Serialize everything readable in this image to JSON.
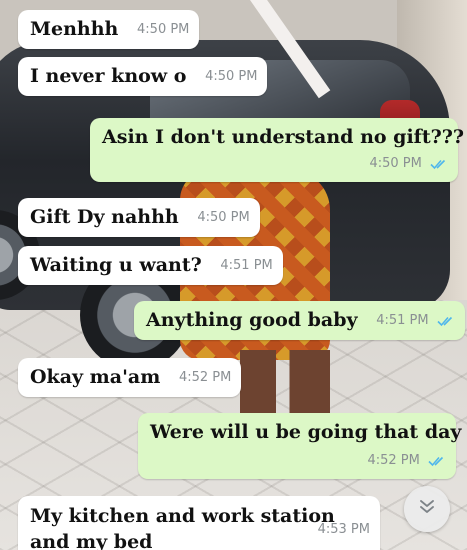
{
  "messages": [
    {
      "id": "m1",
      "direction": "incoming",
      "text": "Menhhh",
      "time": "4:50 PM"
    },
    {
      "id": "m2",
      "direction": "incoming",
      "text": "I never know o",
      "time": "4:50 PM"
    },
    {
      "id": "m3",
      "direction": "outgoing",
      "text": "Asin I don't understand no gift???",
      "time": "4:50 PM",
      "status": "read"
    },
    {
      "id": "m4",
      "direction": "incoming",
      "text": "Gift Dy nahhh",
      "time": "4:50 PM"
    },
    {
      "id": "m5",
      "direction": "incoming",
      "text": "Waiting u want?",
      "time": "4:51 PM"
    },
    {
      "id": "m6",
      "direction": "outgoing",
      "text": "Anything good baby",
      "time": "4:51 PM",
      "status": "read"
    },
    {
      "id": "m7",
      "direction": "incoming",
      "text": "Okay ma'am",
      "time": "4:52 PM"
    },
    {
      "id": "m8",
      "direction": "outgoing",
      "text": "Were will u be going that day",
      "time": "4:52 PM",
      "status": "read"
    },
    {
      "id": "m9",
      "direction": "incoming",
      "text": "My kitchen and work station and my bed",
      "time": "4:53 PM"
    }
  ],
  "colors": {
    "incoming_bubble": "#ffffff",
    "outgoing_bubble": "#dcf8c6",
    "read_ticks": "#4fb6ec",
    "timestamp": "#8a8f93"
  },
  "icons": {
    "read_receipt": "double-check-icon",
    "scroll_down": "chevron-double-down-icon"
  }
}
